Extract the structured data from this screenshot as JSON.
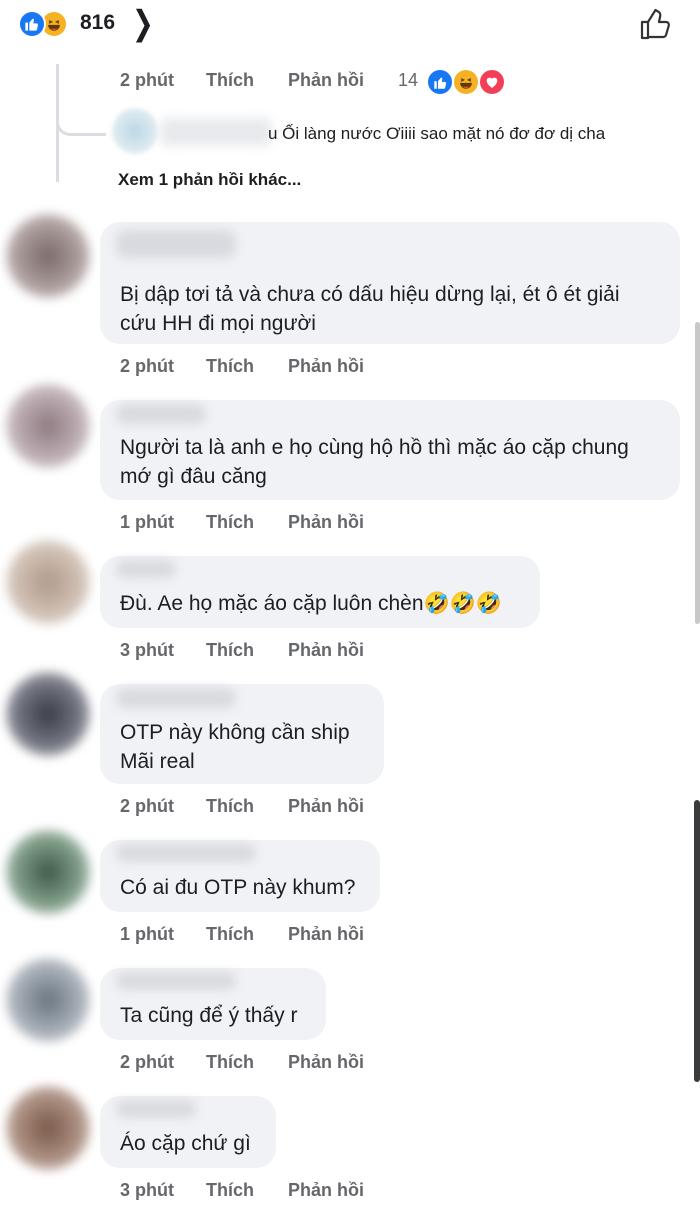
{
  "header": {
    "reaction_count": "816",
    "reaction_icons": [
      "like-icon",
      "haha-icon"
    ],
    "chevron": "chevron-right-icon",
    "like_icon": "thumbs-up-outline-icon"
  },
  "colors": {
    "like": "#1877f2",
    "haha": "#f7b125",
    "love": "#f33e58",
    "bubble": "#f0f2f5",
    "meta": "#65676b"
  },
  "first_meta": {
    "time": "2 phút",
    "like": "Thích",
    "reply": "Phản hồi",
    "reaction_count": "14",
    "reactions": [
      "like-icon",
      "haha-icon",
      "love-icon"
    ]
  },
  "nested_reply": {
    "text": "u Ối làng nước Ơiiii  sao mặt nó đơ đơ dị cha"
  },
  "more_replies": "Xem 1 phản hồi khác...",
  "comments": [
    {
      "lines": [
        "Bị dập tơi tả và chưa có dấu hiệu dừng lại, ét ô ét giải",
        "cứu HH đi mọi người"
      ],
      "time": "2 phút",
      "like": "Thích",
      "reply": "Phản hồi"
    },
    {
      "lines": [
        "Người ta là anh e họ cùng hộ hồ thì mặc áo cặp chung",
        "mớ gì đâu căng"
      ],
      "time": "1 phút",
      "like": "Thích",
      "reply": "Phản hồi"
    },
    {
      "lines": [
        "Đù. Ae họ mặc áo cặp luôn chèn🤣🤣🤣"
      ],
      "time": "3 phút",
      "like": "Thích",
      "reply": "Phản hồi"
    },
    {
      "lines": [
        "OTP này không cần ship",
        "Mãi real"
      ],
      "time": "2 phút",
      "like": "Thích",
      "reply": "Phản hồi"
    },
    {
      "lines": [
        "Có ai đu OTP này khum?"
      ],
      "time": "1 phút",
      "like": "Thích",
      "reply": "Phản hồi"
    },
    {
      "lines": [
        "Ta cũng để ý thấy r"
      ],
      "time": "2 phút",
      "like": "Thích",
      "reply": "Phản hồi"
    },
    {
      "lines": [
        "Áo cặp chứ gì"
      ],
      "time": "3 phút",
      "like": "Thích",
      "reply": "Phản hồi"
    }
  ]
}
